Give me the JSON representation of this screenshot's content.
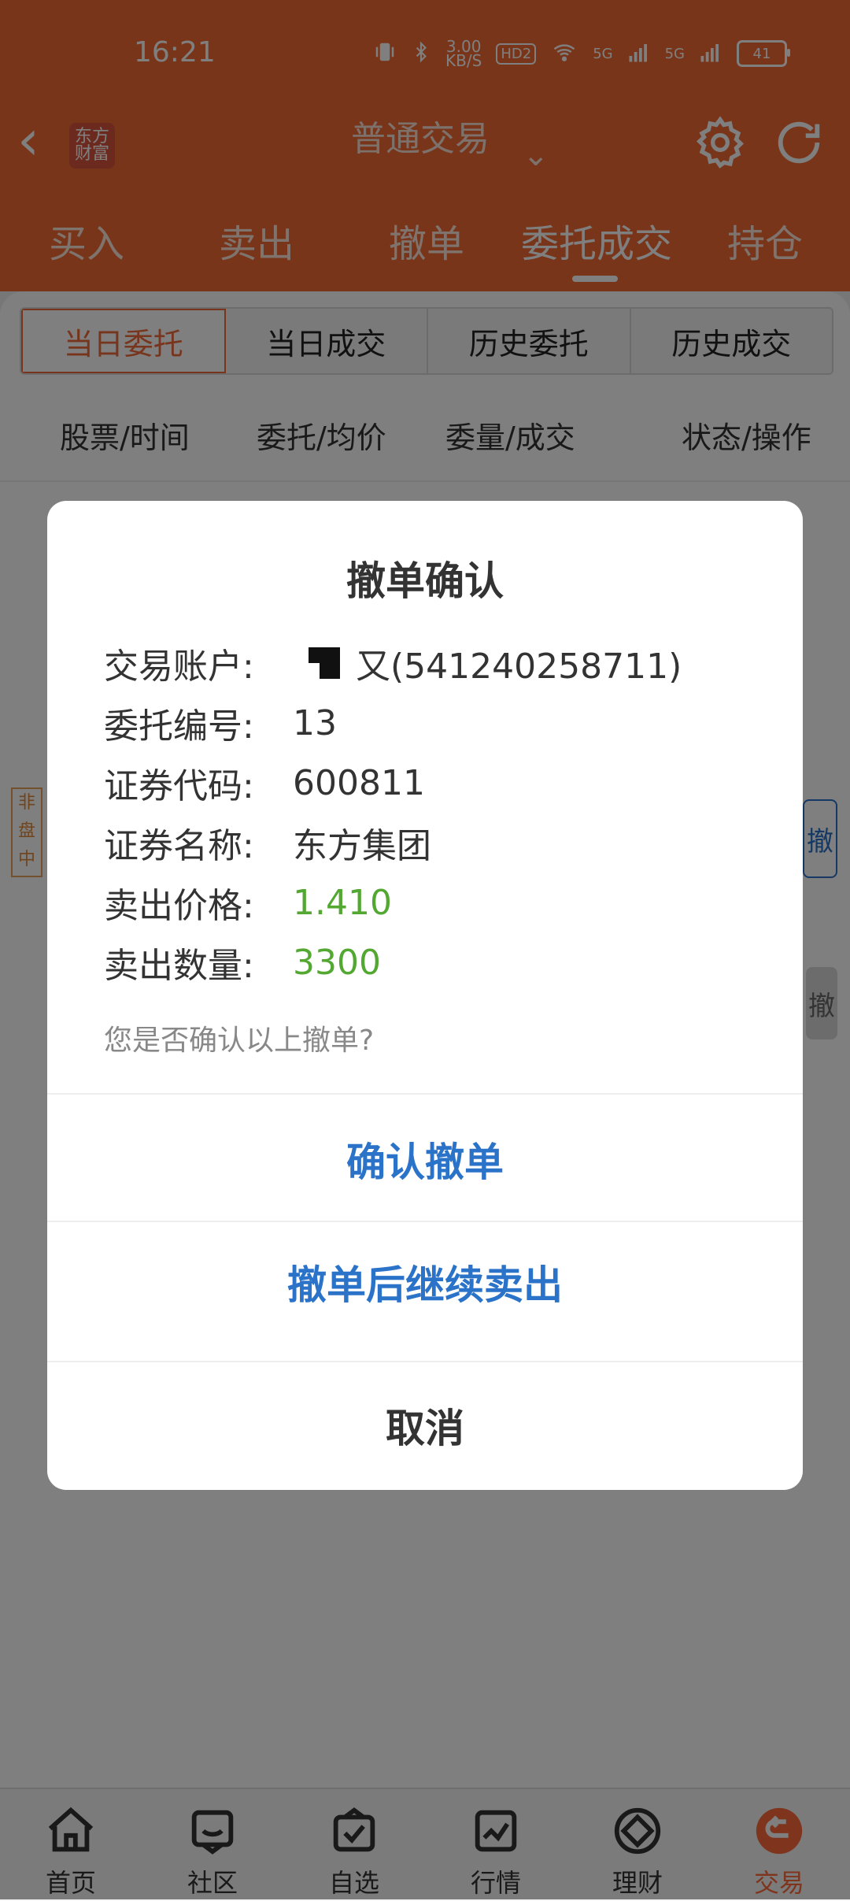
{
  "colors": {
    "brand": "#F26A33",
    "accent_blue": "#2b73c9",
    "accent_green": "#53a832"
  },
  "status": {
    "time": "16:21",
    "speed_value": "3.00",
    "speed_unit": "KB/S",
    "hd": "HD2",
    "net1": "5G",
    "net2": "5G",
    "battery": "41"
  },
  "header": {
    "logo_line1": "东方",
    "logo_line2": "财富",
    "title": "普通交易",
    "icons": {
      "back": "back-chevron-icon",
      "gear": "gear-icon",
      "refresh": "refresh-icon"
    }
  },
  "tabs": [
    {
      "label": "买入"
    },
    {
      "label": "卖出"
    },
    {
      "label": "撤单"
    },
    {
      "label": "委托成交"
    },
    {
      "label": "持仓"
    }
  ],
  "segments": [
    {
      "label": "当日委托"
    },
    {
      "label": "当日成交"
    },
    {
      "label": "历史委托"
    },
    {
      "label": "历史成交"
    }
  ],
  "table_head": [
    "股票/时间",
    "委托/均价",
    "委量/成交",
    "状态/操作"
  ],
  "row": {
    "badge": "非盘中",
    "btn": "撤"
  },
  "modal": {
    "title": "撤单确认",
    "fields": [
      {
        "label": "交易账户:",
        "value": "又(541240258711)"
      },
      {
        "label": "委托编号:",
        "value": "13"
      },
      {
        "label": "证券代码:",
        "value": "600811"
      },
      {
        "label": "证券名称:",
        "value": "东方集团"
      },
      {
        "label": "卖出价格:",
        "value": "1.410"
      },
      {
        "label": "卖出数量:",
        "value": "3300"
      }
    ],
    "question": "您是否确认以上撤单?",
    "actions": [
      {
        "label": "确认撤单"
      },
      {
        "label": "撤单后继续卖出"
      },
      {
        "label": "取消"
      }
    ]
  },
  "bottom_nav": [
    {
      "label": "首页",
      "icon": "home-icon"
    },
    {
      "label": "社区",
      "icon": "chat-icon"
    },
    {
      "label": "自选",
      "icon": "basket-icon"
    },
    {
      "label": "行情",
      "icon": "chart-icon"
    },
    {
      "label": "理财",
      "icon": "diamond-icon"
    },
    {
      "label": "交易",
      "icon": "trade-icon"
    }
  ]
}
